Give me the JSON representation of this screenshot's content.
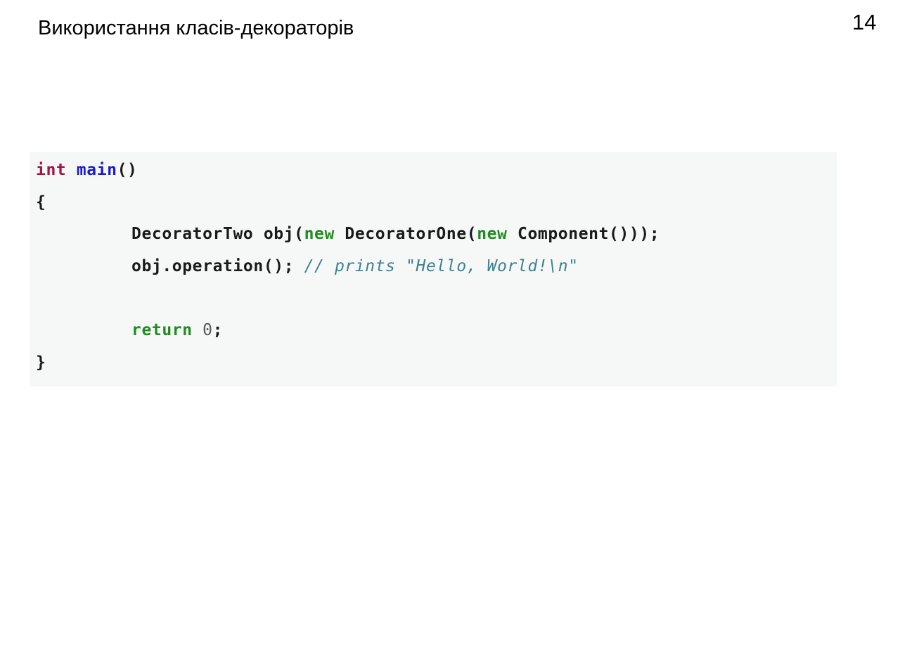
{
  "slide": {
    "title": "Використання класів-декораторів",
    "number": "14"
  },
  "code": {
    "line1": {
      "type": "int",
      "func": "main",
      "rest": "()"
    },
    "line2": {
      "text": "{"
    },
    "line3": {
      "a": "DecoratorTwo obj(",
      "kw1": "new",
      "b": " DecoratorOne(",
      "kw2": "new",
      "c": " Component()));"
    },
    "line4": {
      "code": "obj.operation(); ",
      "comment": "// prints \"Hello, World!\\n\""
    },
    "line6": {
      "kw": "return",
      "num": " 0",
      "rest": ";"
    },
    "line7": {
      "text": "}"
    }
  },
  "colors": {
    "code_background": "#f6f8f8",
    "type": "#a31544",
    "function": "#1b1bcc",
    "keyword": "#228b22",
    "comment": "#3f7f8f"
  }
}
